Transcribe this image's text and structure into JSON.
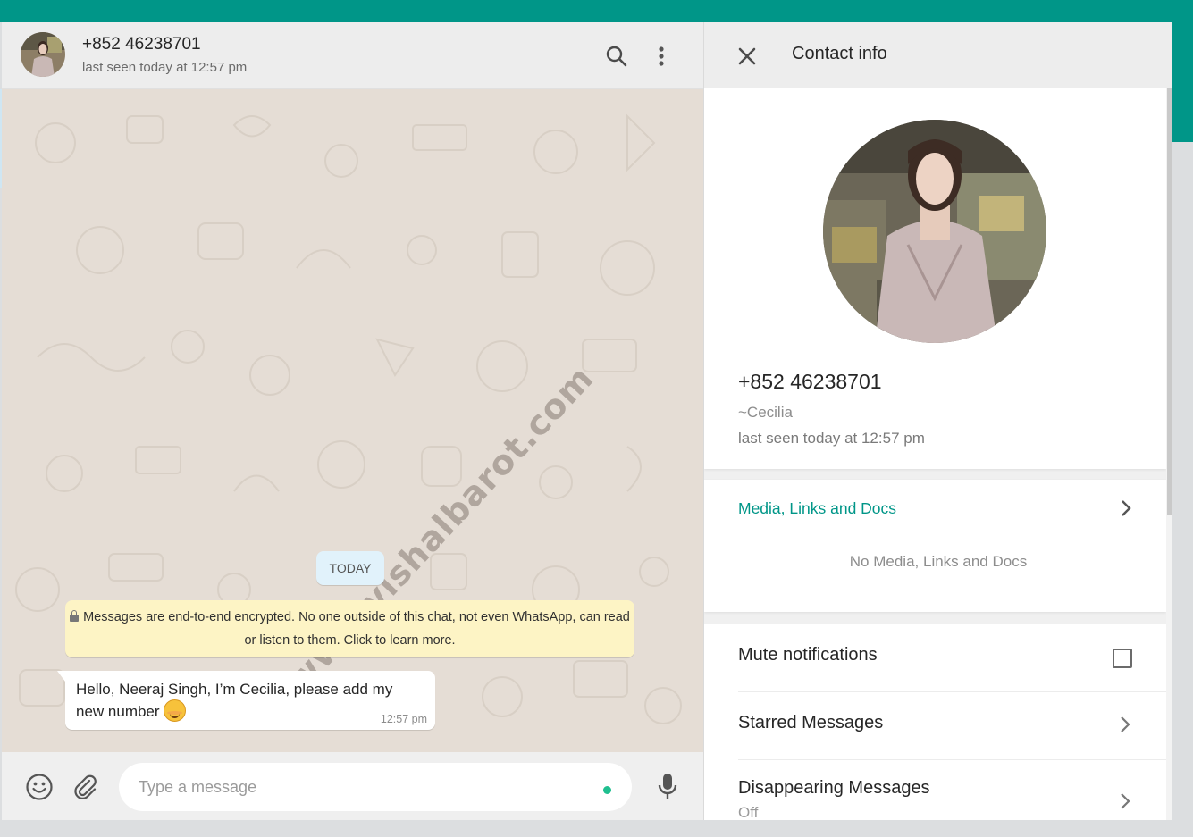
{
  "chat_header": {
    "title": "+852 46238701",
    "subtitle": "last seen today at 12:57 pm",
    "icons": [
      "search-icon",
      "menu-dots-icon"
    ]
  },
  "chat": {
    "watermark": "www.vishalbarot.com",
    "date_pill": "TODAY",
    "encryption_notice": "Messages are end-to-end encrypted. No one outside of this chat, not even WhatsApp, can read or listen to them. Click to learn more.",
    "message": {
      "text": "Hello, Neeraj Singh, I’m Cecilia, please add my new number",
      "emoji": "smiling-face-with-blush",
      "time": "12:57 pm"
    }
  },
  "composer": {
    "placeholder": "Type a message",
    "icons": [
      "emoji-icon",
      "attach-icon",
      "mic-icon"
    ]
  },
  "contact_info": {
    "title": "Contact info",
    "number": "+852 46238701",
    "name": "~Cecilia",
    "last_seen": "last seen today at 12:57 pm",
    "media": {
      "title": "Media, Links and Docs",
      "empty": "No Media, Links and Docs"
    },
    "settings": {
      "mute": "Mute notifications",
      "mute_checked": false,
      "starred": "Starred Messages",
      "disappearing": "Disappearing Messages",
      "disappearing_value": "Off"
    }
  },
  "colors": {
    "brand": "#009688",
    "chat_background": "#e5ddd5",
    "notice_background": "#fdf4c5",
    "date_pill_background": "#e1f2fb",
    "online_dot": "#1fbf8f"
  }
}
